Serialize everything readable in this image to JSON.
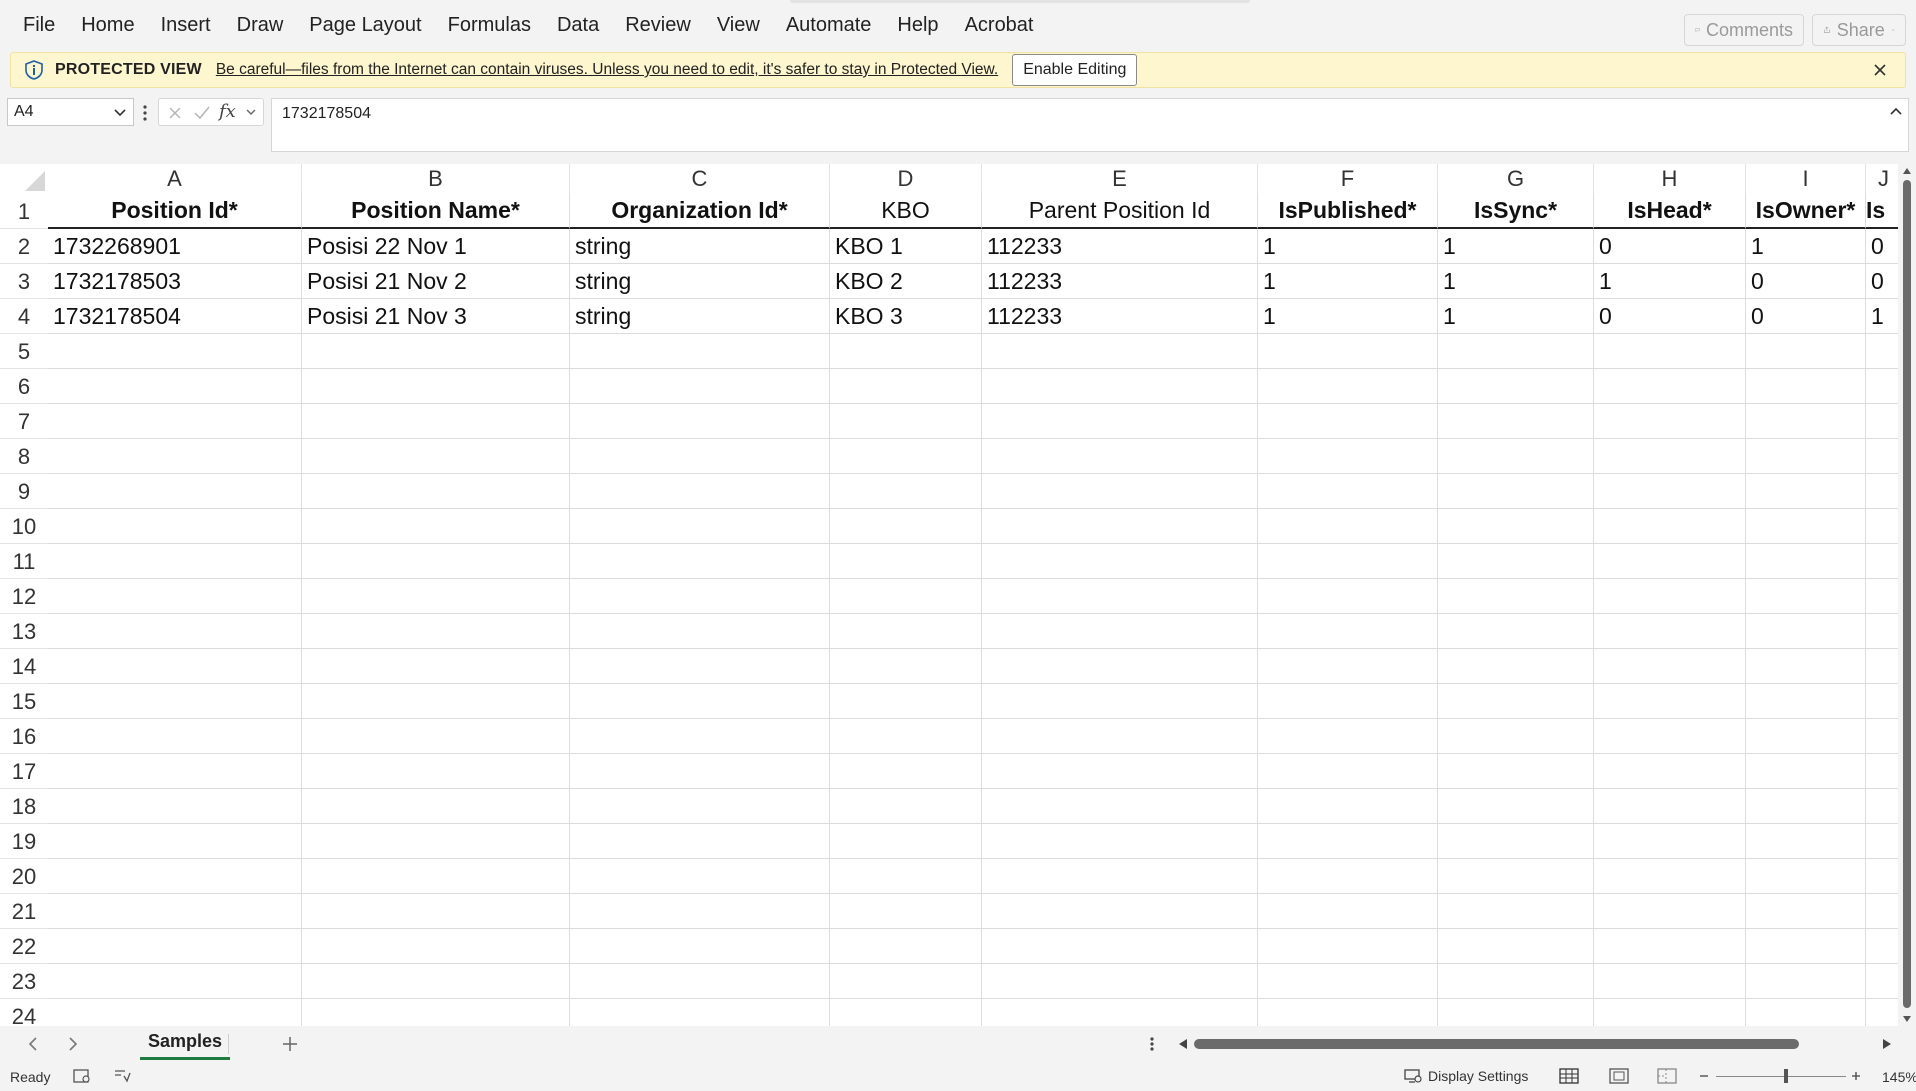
{
  "ribbon": {
    "tabs": [
      "File",
      "Home",
      "Insert",
      "Draw",
      "Page Layout",
      "Formulas",
      "Data",
      "Review",
      "View",
      "Automate",
      "Help",
      "Acrobat"
    ],
    "comments_label": "Comments",
    "share_label": "Share"
  },
  "protected_view": {
    "label": "PROTECTED VIEW",
    "message": "Be careful—files from the Internet can contain viruses. Unless you need to edit, it's safer to stay in Protected View.",
    "enable_label": "Enable Editing"
  },
  "formula_bar": {
    "name_box": "A4",
    "fx_label": "fx",
    "value": "1732178504"
  },
  "grid": {
    "column_letters": [
      "A",
      "B",
      "C",
      "D",
      "E",
      "F",
      "G",
      "H",
      "I",
      "J"
    ],
    "row_numbers": [
      "1",
      "2",
      "3",
      "4",
      "5",
      "6",
      "7",
      "8",
      "9",
      "10",
      "11",
      "12",
      "13",
      "14",
      "15",
      "16",
      "17",
      "18",
      "19",
      "20",
      "21",
      "22",
      "23",
      "24"
    ],
    "header_row": [
      "Position Id*",
      "Position Name*",
      "Organization Id*",
      "KBO",
      "Parent Position Id",
      "IsPublished*",
      "IsSync*",
      "IsHead*",
      "IsOwner*",
      "Is"
    ],
    "rows": [
      [
        "1732268901",
        "Posisi 22 Nov 1",
        "string",
        "KBO 1",
        "112233",
        "1",
        "1",
        "0",
        "1",
        "0"
      ],
      [
        "1732178503",
        "Posisi 21 Nov 2",
        "string",
        "KBO 2",
        "112233",
        "1",
        "1",
        "1",
        "0",
        "0"
      ],
      [
        "1732178504",
        "Posisi 21 Nov 3",
        "string",
        "KBO 3",
        "112233",
        "1",
        "1",
        "0",
        "0",
        "1"
      ]
    ]
  },
  "sheets": {
    "active": "Samples"
  },
  "status_bar": {
    "ready": "Ready",
    "display_settings": "Display Settings",
    "zoom": "145%"
  }
}
